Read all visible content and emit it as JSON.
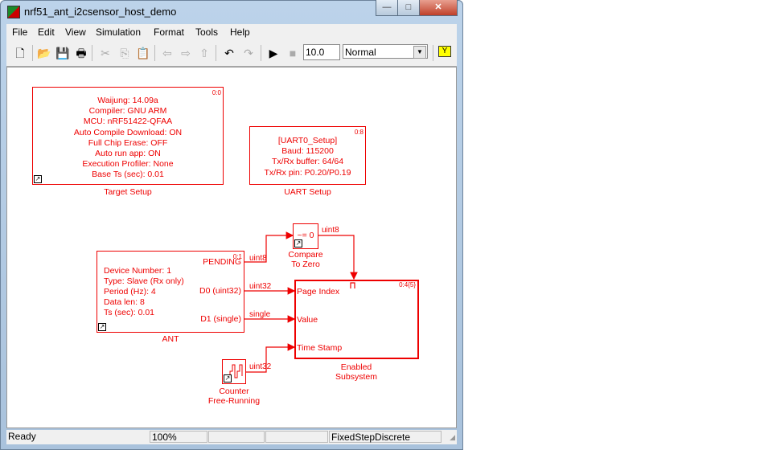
{
  "window": {
    "title": "nrf51_ant_i2csensor_host_demo"
  },
  "menu": [
    "File",
    "Edit",
    "View",
    "Simulation",
    "Format",
    "Tools",
    "Help"
  ],
  "toolbar": {
    "stop_time": "10.0",
    "sim_mode": "Normal"
  },
  "blocks": {
    "target": {
      "priority": "0:0",
      "lines": [
        "Waijung: 14.09a",
        "Compiler: GNU ARM",
        "MCU: nRF51422-QFAA",
        "Auto Compile Download: ON",
        "Full Chip Erase: OFF",
        "Auto run app: ON",
        "Execution Profiler: None",
        "Base Ts (sec): 0.01"
      ],
      "label": "Target Setup"
    },
    "uart": {
      "priority": "0:8",
      "lines": [
        "[UART0_Setup]",
        "Baud: 115200",
        "Tx/Rx buffer: 64/64",
        "Tx/Rx pin: P0.20/P0.19"
      ],
      "label": "UART Setup"
    },
    "compare": {
      "text": "~= 0",
      "label": [
        "Compare",
        "To Zero"
      ]
    },
    "ant": {
      "priority": "0:1",
      "lines": [
        "Device Number: 1",
        "Type: Slave (Rx only)",
        "Period (Hz): 4",
        "Data len: 8",
        "Ts (sec): 0.01"
      ],
      "ports": [
        "PENDING",
        "D0 (uint32)",
        "D1 (single)"
      ],
      "label": "ANT"
    },
    "subsystem": {
      "priority": "0:4{5}",
      "ports": [
        "Page Index",
        "Value",
        "Time Stamp"
      ],
      "label": [
        "Enabled",
        "Subsystem"
      ]
    },
    "counter": {
      "label": [
        "Counter",
        "Free-Running"
      ]
    }
  },
  "signals": {
    "pending": "uint8",
    "compare_out": "uint8",
    "d0": "uint32",
    "d1": "single",
    "counter": "uint32"
  },
  "status": {
    "left": "Ready",
    "zoom": "100%",
    "solver": "FixedStepDiscrete"
  },
  "colors": {
    "block": "#e00000"
  }
}
